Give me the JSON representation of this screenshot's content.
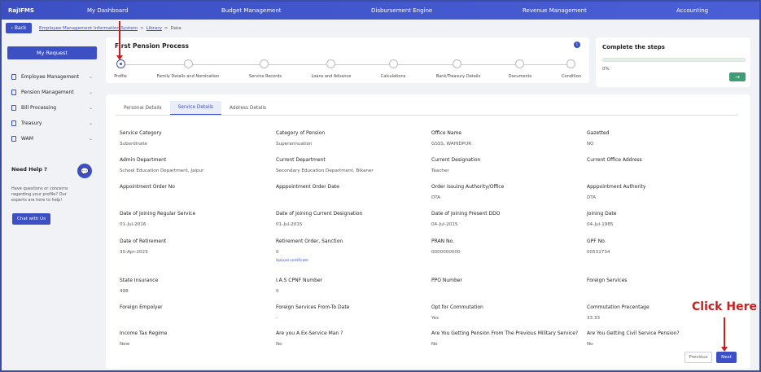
{
  "app": {
    "brand": "RajIFMS"
  },
  "topnav": {
    "items": [
      "My Dashboard",
      "Budget Management",
      "Disbursement Engine",
      "Revenue Management",
      "Accounting"
    ]
  },
  "breadcrumb": {
    "back_label": "Back",
    "items": [
      "Employee Management Information System",
      "Library",
      "Data"
    ],
    "separator": ">"
  },
  "sidebar": {
    "my_request": "My Request",
    "items": [
      {
        "label": "Employee Management",
        "icon": "document-icon"
      },
      {
        "label": "Pension Management",
        "icon": "document-icon"
      },
      {
        "label": "Bill Processing",
        "icon": "document-icon"
      },
      {
        "label": "Treasury",
        "icon": "document-icon"
      },
      {
        "label": "WAM",
        "icon": "document-icon"
      }
    ],
    "need_help": "Need Help ?",
    "help_text": "Have questions or concerns regarding your profile? Our experts are here to help!",
    "chat_button": "Chat with Us"
  },
  "process": {
    "title": "First Pension Process",
    "steps": [
      "Profile",
      "Family Details and Nomination",
      "Service Records",
      "Loans and Advance",
      "Calculations",
      "Bank/Treasury Details",
      "Documents",
      "Condition"
    ],
    "active_step": 0
  },
  "complete_steps": {
    "title": "Complete the steps",
    "progress_percent": 0,
    "progress_label": "0%",
    "button_glyph": "→"
  },
  "tabs": {
    "items": [
      "Personal Details",
      "Service Details",
      "Address Details"
    ],
    "active": 1
  },
  "fields": [
    {
      "label": "Service Category",
      "value": "Subordinate"
    },
    {
      "label": "Category of Pension",
      "value": "Superannuation"
    },
    {
      "label": "Office Name",
      "value": "GSSS, WAHIDPUR"
    },
    {
      "label": "Gazetted",
      "value": "NO"
    },
    {
      "label": "Admin Department",
      "value": "School Education Department, Jaipur"
    },
    {
      "label": "Current Department",
      "value": "Secondary Education Department, Bikaner"
    },
    {
      "label": "Current Designation",
      "value": "Teacher"
    },
    {
      "label": "Current Office Address",
      "value": ""
    },
    {
      "label": "Appointment Order No",
      "value": ""
    },
    {
      "label": "Apppointment Order Date",
      "value": ""
    },
    {
      "label": "Order Issuing Authority/Office",
      "value": "DTA"
    },
    {
      "label": "Apppointment Authority",
      "value": "DTA"
    },
    {
      "label": "Date of Joining Regular Service",
      "value": "01-Jul-2016"
    },
    {
      "label": "Date of Joining Current Designation",
      "value": "01-Jul-2015"
    },
    {
      "label": "Date of Joining Present DDO",
      "value": "04-Jul-2015"
    },
    {
      "label": "Joining Date",
      "value": "04-Jul-1985"
    },
    {
      "label": "Date of Retirement",
      "value": "30-Apr-2023"
    },
    {
      "label": "Retirement Order, Sanction",
      "value": "0"
    },
    {
      "label": "PRAN No.",
      "value": "0000000000"
    },
    {
      "label": "GPF No.",
      "value": "00532734"
    },
    {
      "label": "State Insurance",
      "value": "498"
    },
    {
      "label": "I.A.S CPNF Number",
      "value": "0"
    },
    {
      "label": "PPO Number",
      "value": ""
    },
    {
      "label": "Foreign Services",
      "value": ""
    },
    {
      "label": "Foreign Empolyer",
      "value": ""
    },
    {
      "label": "Foreign Services From-To Date",
      "value": "-"
    },
    {
      "label": "Opt for Commutation",
      "value": "Yes"
    },
    {
      "label": "Commutation Precentage",
      "value": "33.33"
    },
    {
      "label": "Income Tax Regime",
      "value": "New"
    },
    {
      "label": "Are you A Ex-Service Man ?",
      "value": "No"
    },
    {
      "label": "Are You Getting Pension From The Previous Military Service?",
      "value": "No"
    },
    {
      "label": "Are You Getting Civil Service Pension?",
      "value": "No"
    }
  ],
  "upload_link": "Upload certificate",
  "buttons": {
    "previous": "Previous",
    "next": "Next"
  },
  "annotation": {
    "text": "Click Here",
    "color": "#c62020"
  },
  "colors": {
    "primary": "#3c50c4",
    "success": "#3e9d74",
    "background": "#f1f2f6"
  }
}
